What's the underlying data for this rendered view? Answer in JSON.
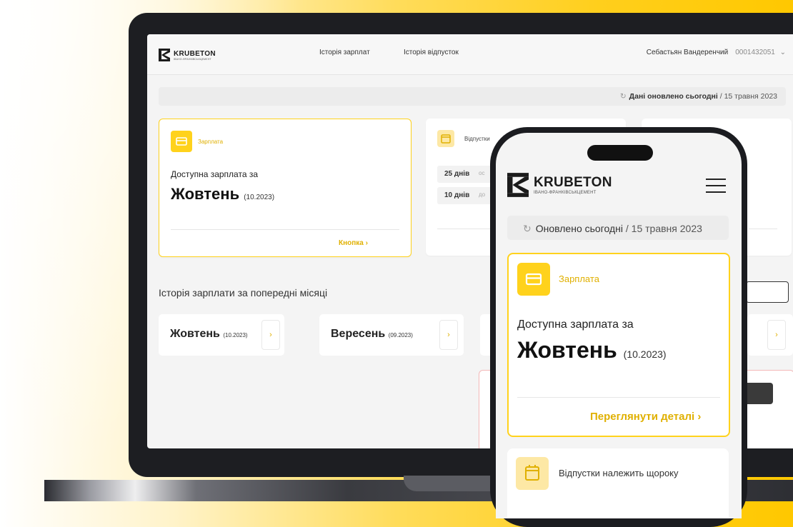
{
  "colors": {
    "accent": "#ffd21c",
    "accent_text": "#e0b000",
    "dark": "#1b1c20"
  },
  "desktop": {
    "logo": {
      "name": "KRUBETON",
      "sub": "ІВАНО-ФРАНКІВСЬКЦЕМЕНТ"
    },
    "nav": [
      "Історія зарплат",
      "Історія відпусток"
    ],
    "user": {
      "name": "Себастьян Вандеренчий",
      "id": "0001432051"
    },
    "update": {
      "prefix": "Дані оновлено сьогодні",
      "date": "/ 15 травня 2023"
    },
    "salary_card": {
      "title": "Зарплата",
      "label": "Доступна зарплата за",
      "month": "Жовтень",
      "period": "(10.2023)",
      "link": "Кнопка"
    },
    "vacation_card": {
      "title": "Відпустки",
      "pills": [
        {
          "days": "25 днів",
          "text": "ос"
        },
        {
          "days": "10 днів",
          "text": "до"
        }
      ]
    },
    "history_title": "Історія зарплати за попередні місяці",
    "history": [
      {
        "month": "Жовтень",
        "period": "(10.2023)"
      },
      {
        "month": "Вересень",
        "period": "(09.2023)"
      }
    ]
  },
  "mobile": {
    "logo": {
      "name": "KRUBETON",
      "sub": "ІВАНО-ФРАНКІВСЬКЦЕМЕНТ"
    },
    "update": {
      "prefix": "Оновлено сьогодні",
      "date": "/ 15 травня 2023"
    },
    "salary_card": {
      "title": "Зарплата",
      "label": "Доступна зарплата за",
      "month": "Жовтень",
      "period": "(10.2023)",
      "link": "Переглянути деталі"
    },
    "vacation_card": {
      "title": "Відпустки належить щороку"
    }
  }
}
